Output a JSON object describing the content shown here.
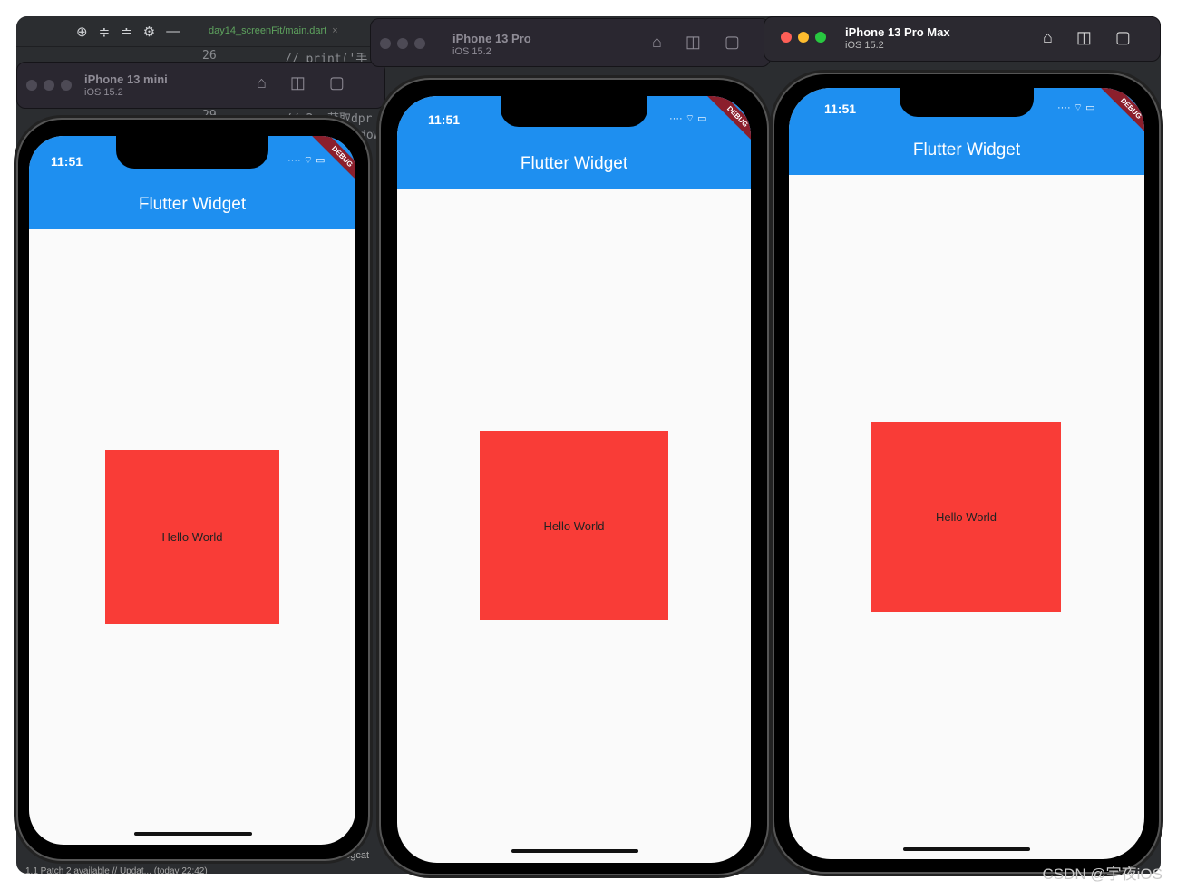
{
  "ide": {
    "tab": "day14_screenFit/main.dart",
    "code_lines": [
      {
        "num": "26",
        "text": "// print('手"
      },
      {
        "num": "29",
        "text": "// 2. 获取dpr"
      }
    ],
    "code_fragment": "dow",
    "logcat": "Logcat",
    "status": "1.1 Patch 2 available // Updat... (today 22:42)"
  },
  "simulators": [
    {
      "device": "iPhone 13 mini",
      "os": "iOS 15.2",
      "time": "11:51",
      "app_title": "Flutter Widget",
      "debug": "DEBUG",
      "box_text": "Hello World"
    },
    {
      "device": "iPhone 13 Pro",
      "os": "iOS 15.2",
      "time": "11:51",
      "app_title": "Flutter Widget",
      "debug": "DEBUG",
      "box_text": "Hello World"
    },
    {
      "device": "iPhone 13 Pro Max",
      "os": "iOS 15.2",
      "time": "11:51",
      "app_title": "Flutter Widget",
      "debug": "DEBUG",
      "box_text": "Hello World"
    }
  ],
  "colors": {
    "appbar": "#1e8ff0",
    "box": "#f93c37",
    "debug_banner": "#8b1f2c"
  },
  "watermark": "CSDN @宇夜iOS"
}
